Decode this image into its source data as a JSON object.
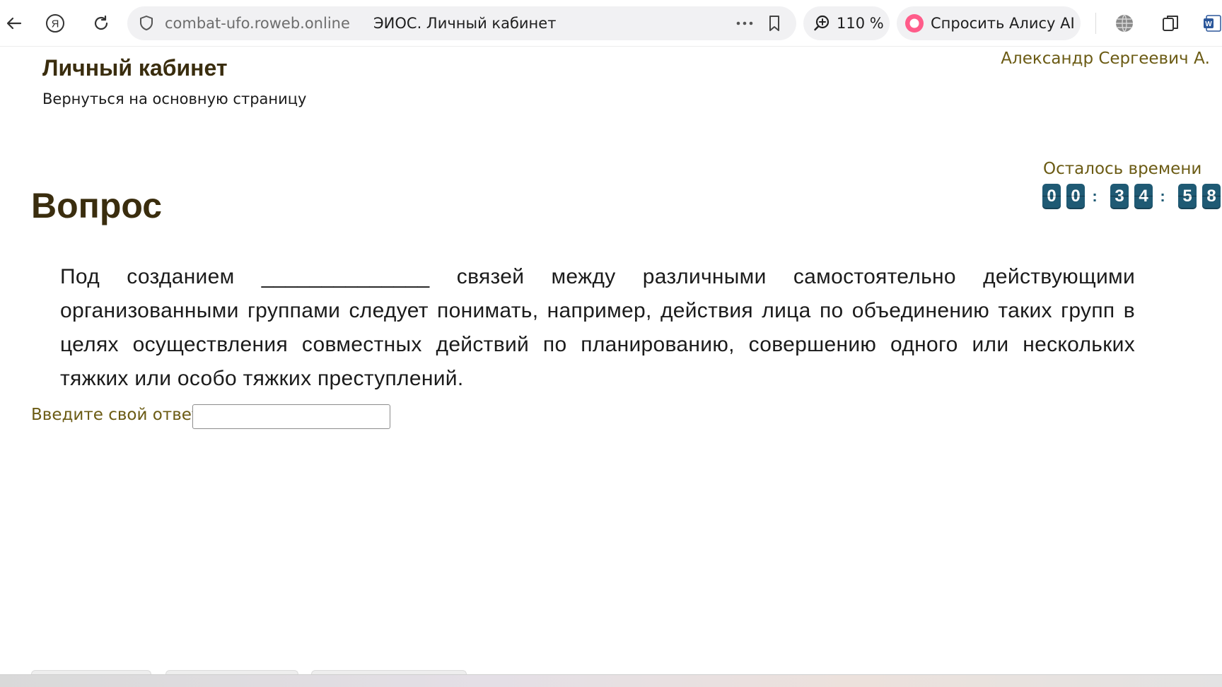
{
  "browser": {
    "host": "combat-ufo.roweb.online",
    "tab_title": "ЭИОС. Личный кабинет",
    "zoom": "110 %",
    "alice_label": "Спросить Алису AI"
  },
  "header": {
    "title": "Личный кабинет",
    "back_link": "Вернуться на основную страницу",
    "user_name": "Александр Сергеевич А."
  },
  "timer": {
    "label": "Осталось времени",
    "digits": [
      "0",
      "0",
      "3",
      "4",
      "5",
      "8"
    ],
    "separator": ":"
  },
  "question": {
    "heading": "Вопрос",
    "text": "Под созданием ______________ связей между различными самостоятельно действующими организованными группами следует понимать, например, действия лица по объединению таких групп в целях осуществления совместных действий по планированию, совершению одного или нескольких тяжких или особо тяжких преступлений.",
    "answer_label": "Введите свой ответ",
    "answer_value": ""
  },
  "colors": {
    "heading": "#3a2d0e",
    "accent_text": "#6b5b14",
    "timer_digit_bg": "#1f5a74",
    "alice_icon": "#ff5c8a"
  }
}
